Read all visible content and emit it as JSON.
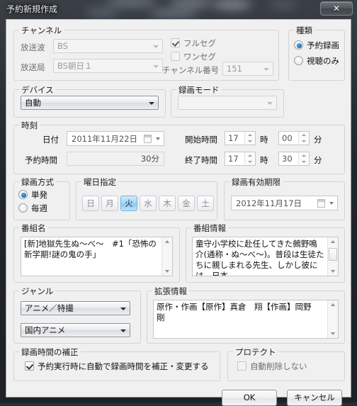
{
  "window": {
    "title": "予約新規作成",
    "close_label": "✕"
  },
  "channel": {
    "legend": "チャンネル",
    "wave_label": "放送波",
    "wave_value": "BS",
    "station_label": "放送局",
    "station_value": "BS朝日１",
    "fullseg_label": "フルセグ",
    "oneseg_label": "ワンセグ",
    "channel_no_label": "チャンネル番号",
    "channel_no_value": "151"
  },
  "type": {
    "legend": "種類",
    "option_record": "予約録画",
    "option_view": "視聴のみ"
  },
  "device": {
    "legend": "デバイス",
    "value": "自動"
  },
  "rec_mode": {
    "legend": "録画モード",
    "value": ""
  },
  "time": {
    "legend": "時刻",
    "date_label": "日付",
    "date_value": "2011年11月22日",
    "duration_label": "予約時間",
    "duration_value": "30分",
    "start_label": "開始時間",
    "start_hour": "17",
    "start_min": "00",
    "end_label": "終了時間",
    "end_hour": "17",
    "end_min": "30",
    "hour_unit": "時",
    "min_unit": "分"
  },
  "rec_method": {
    "legend": "録画方式",
    "option_single": "単発",
    "option_weekly": "毎週"
  },
  "weekday": {
    "legend": "曜日指定",
    "days": [
      "日",
      "月",
      "火",
      "水",
      "木",
      "金",
      "土"
    ],
    "selected": "火"
  },
  "expiry": {
    "legend": "録画有効期限",
    "value": "2012年11月17日"
  },
  "program_name": {
    "legend": "番組名",
    "value": "[新]地獄先生ぬ～べ～　#1「恐怖の新学期!謎の鬼の手」"
  },
  "program_info": {
    "legend": "番組情報",
    "value": "童守小学校に赴任してきた鵺野鳴介(通称・ぬ～べ～)。普段は生徒たちに親しまれる先生、しかし彼には、日本"
  },
  "genre": {
    "legend": "ジャンル",
    "primary": "アニメ／特撮",
    "secondary": "国内アニメ"
  },
  "ext_info": {
    "legend": "拡張情報",
    "value": "原作・作画【原作】真倉　翔【作画】岡野　剛"
  },
  "correction": {
    "legend": "録画時間の補正",
    "checkbox_label": "予約実行時に自動で録画時間を補正・変更する"
  },
  "protect": {
    "legend": "プロテクト",
    "checkbox_label": "自動削除しない"
  },
  "buttons": {
    "ok": "OK",
    "cancel": "キャンセル"
  }
}
